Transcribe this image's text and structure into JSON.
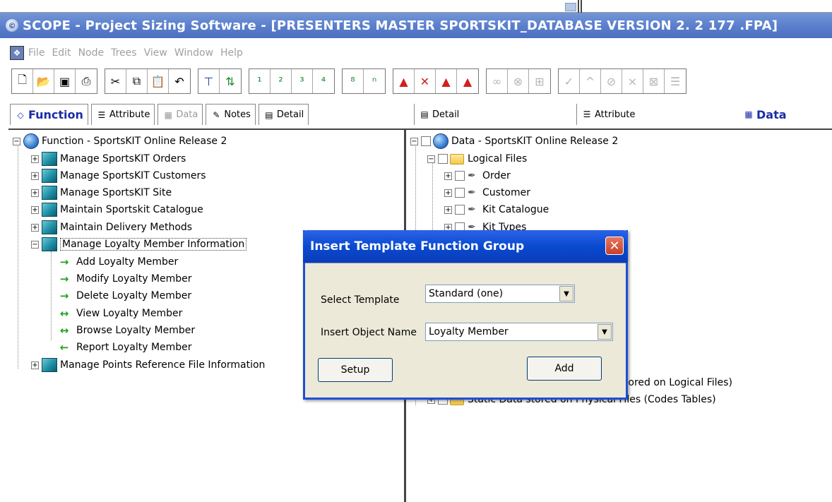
{
  "window": {
    "title": "SCOPE - Project Sizing Software  - [PRESENTERS MASTER SPORTSKIT_DATABASE VERSION 2. 2 177 .FPA]"
  },
  "menu": {
    "items": [
      "File",
      "Edit",
      "Node",
      "Trees",
      "View",
      "Window",
      "Help"
    ]
  },
  "left_tabs": [
    {
      "label": "Function",
      "icon": "function-icon",
      "state": "active"
    },
    {
      "label": "Attribute",
      "icon": "attribute-icon",
      "state": "normal"
    },
    {
      "label": "Data",
      "icon": "data-icon",
      "state": "disabled"
    },
    {
      "label": "Notes",
      "icon": "notes-icon",
      "state": "normal"
    },
    {
      "label": "Detail",
      "icon": "detail-icon",
      "state": "normal"
    }
  ],
  "right_tabs": [
    {
      "label": "Detail",
      "icon": "detail-icon",
      "state": "normal"
    },
    {
      "label": "Attribute",
      "icon": "attribute-icon",
      "state": "normal"
    },
    {
      "label": "Data",
      "icon": "data-icon",
      "state": "active"
    }
  ],
  "function_tree": {
    "root": "Function - SportsKIT Online Release 2",
    "groups": [
      "Manage SportsKIT Orders",
      "Manage SportsKIT Customers",
      "Manage SportsKIT Site",
      "Maintain Sportskit Catalogue",
      "Maintain Delivery Methods",
      "Manage Loyalty Member Information"
    ],
    "children": [
      {
        "label": "Add Loyalty Member",
        "arrow": "→"
      },
      {
        "label": "Modify Loyalty Member",
        "arrow": "→"
      },
      {
        "label": "Delete Loyalty Member",
        "arrow": "→"
      },
      {
        "label": "View Loyalty Member",
        "arrow": "↔"
      },
      {
        "label": "Browse Loyalty Member",
        "arrow": "↔"
      },
      {
        "label": "Report Loyalty Member",
        "arrow": "←"
      }
    ],
    "last_group": "Manage Points Reference File Information"
  },
  "data_tree": {
    "root": "Data - SportsKIT Online Release 2",
    "logical_files": "Logical Files",
    "files": [
      "Order",
      "Customer",
      "Kit Catalogue",
      "Kit Types"
    ],
    "partial_1": "Stored on Logical Files)",
    "partial_2": "Static Data stored on Physical Files (Codes Tables)"
  },
  "dialog": {
    "title": "Insert Template Function Group",
    "template_label": "Select Template",
    "template_value": "Standard  (one)",
    "name_label": "Insert Object Name",
    "name_value": "Loyalty Member",
    "setup_label": "Setup",
    "add_label": "Add"
  }
}
